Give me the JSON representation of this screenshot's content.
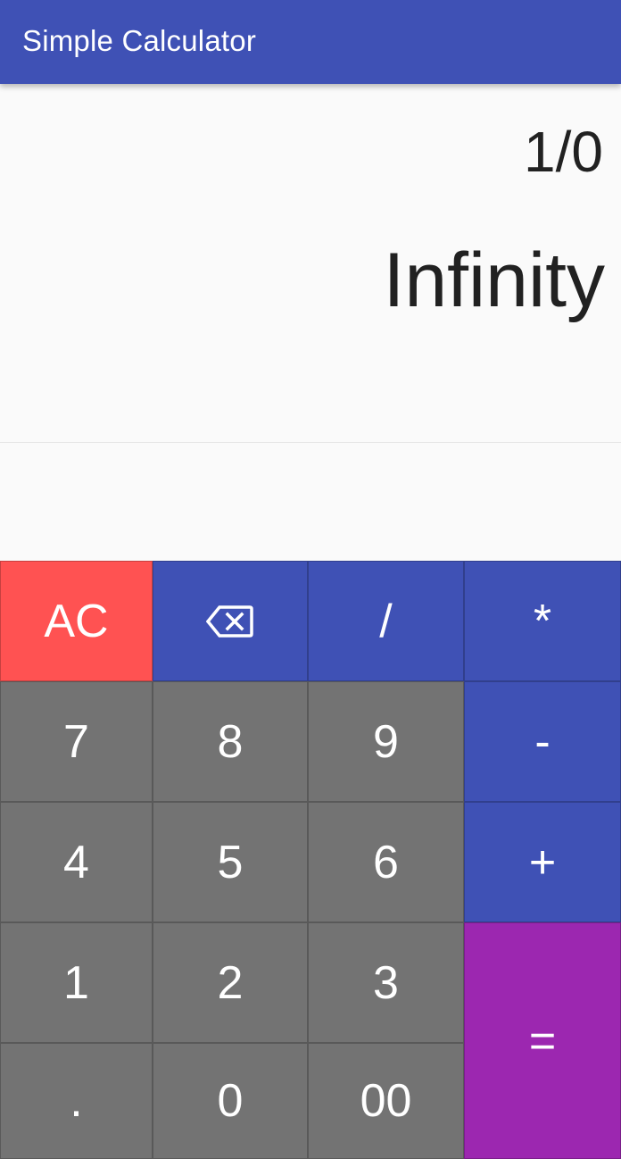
{
  "app": {
    "title": "Simple Calculator"
  },
  "display": {
    "expression": "1/0",
    "result": "Infinity"
  },
  "keypad": {
    "ac": "AC",
    "backspace_icon": "backspace-icon",
    "divide": "/",
    "multiply": "*",
    "subtract": "-",
    "add": "+",
    "equals": "=",
    "decimal": ".",
    "double_zero": "00",
    "digits": {
      "d0": "0",
      "d1": "1",
      "d2": "2",
      "d3": "3",
      "d4": "4",
      "d5": "5",
      "d6": "6",
      "d7": "7",
      "d8": "8",
      "d9": "9"
    }
  },
  "colors": {
    "primary": "#3f51b5",
    "clear": "#ff5252",
    "equals": "#9c27b0",
    "number_key": "#737373",
    "background": "#fafafa"
  }
}
